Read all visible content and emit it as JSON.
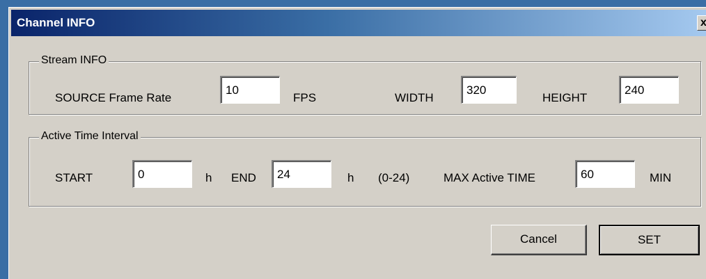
{
  "window": {
    "title": "Channel INFO",
    "close_symbol": "x"
  },
  "stream_info": {
    "label": "Stream INFO",
    "source_frame_rate_label": "SOURCE Frame Rate",
    "source_frame_rate_value": "10",
    "fps_label": "FPS",
    "width_label": "WIDTH",
    "width_value": "320",
    "height_label": "HEIGHT",
    "height_value": "240"
  },
  "active_time": {
    "label": "Active Time Interval",
    "start_label": "START",
    "start_value": "0",
    "start_unit": "h",
    "end_label": "END",
    "end_value": "24",
    "end_unit": "h",
    "range_hint": "(0-24)",
    "max_active_label": "MAX Active TIME",
    "max_active_value": "60",
    "max_active_unit": "MIN"
  },
  "buttons": {
    "cancel": "Cancel",
    "set": "SET"
  }
}
